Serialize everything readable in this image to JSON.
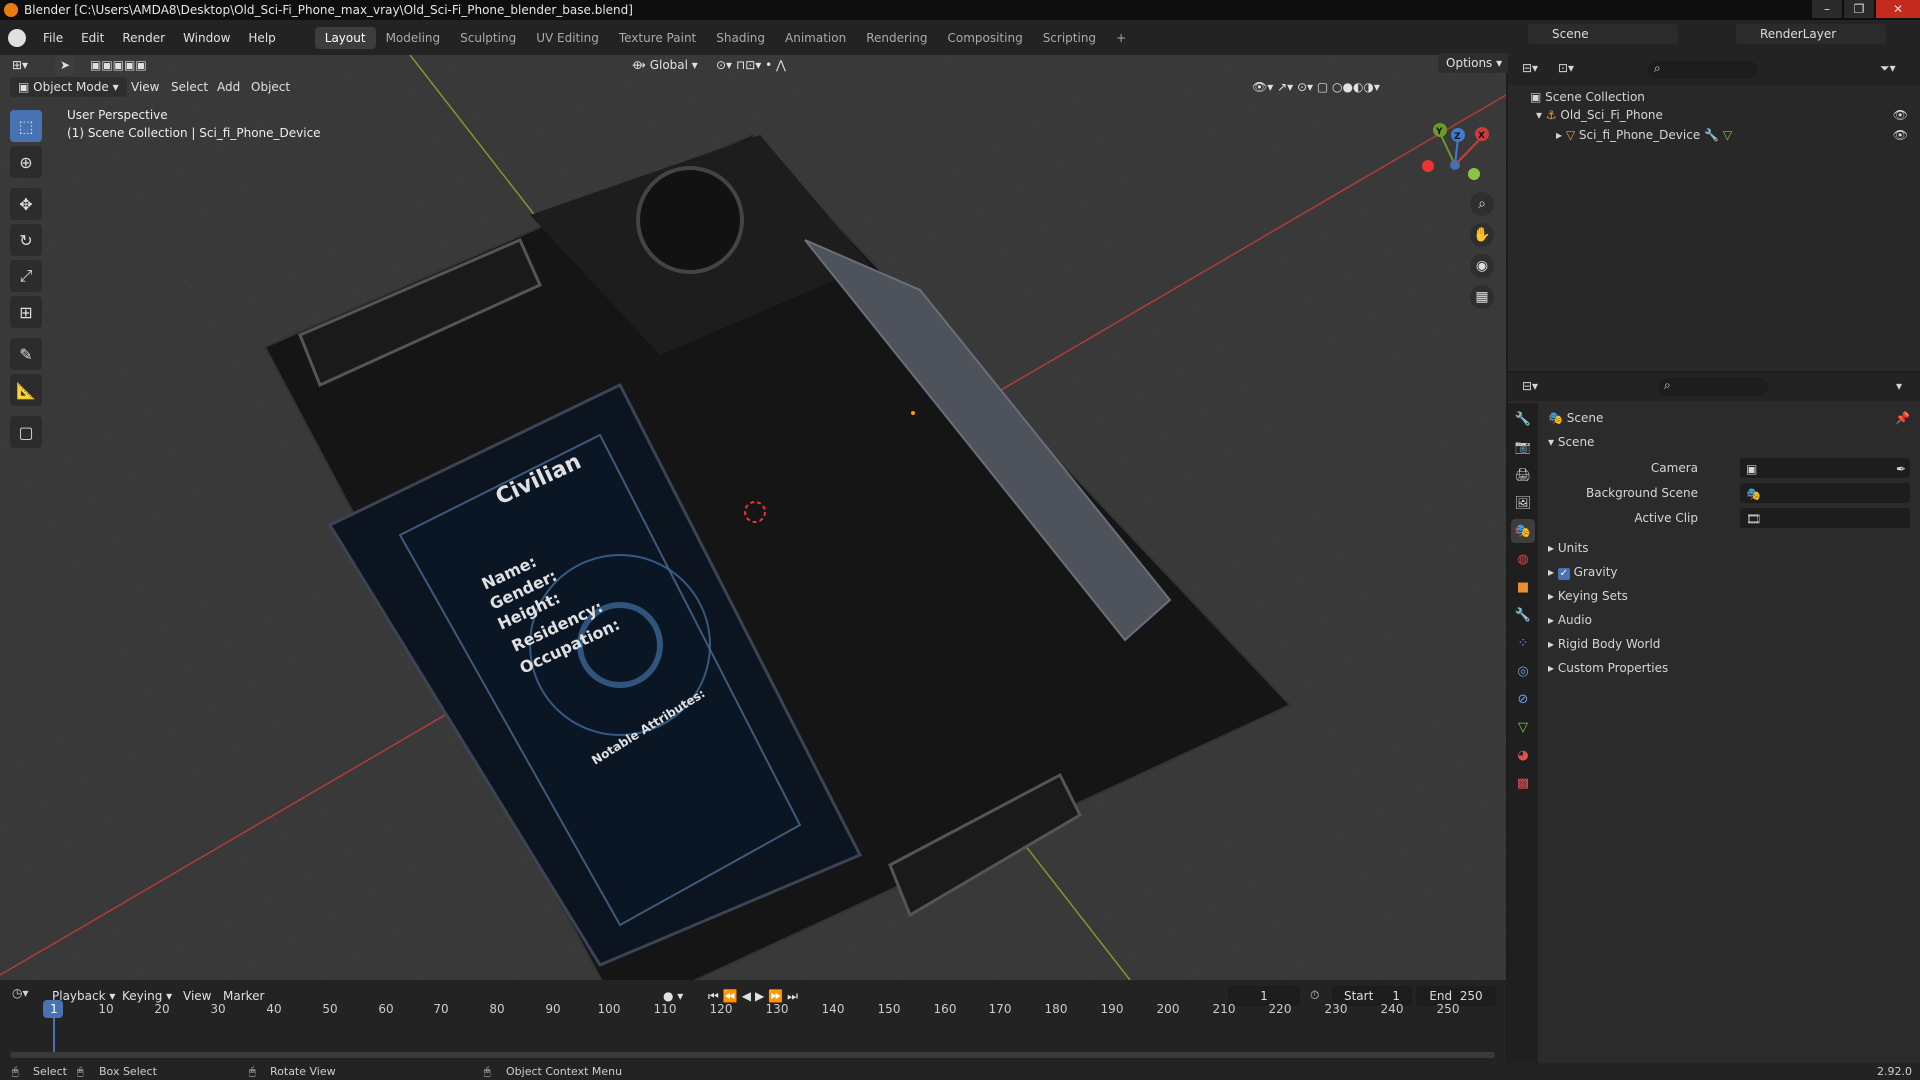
{
  "title": "Blender [C:\\Users\\AMDA8\\Desktop\\Old_Sci-Fi_Phone_max_vray\\Old_Sci-Fi_Phone_blender_base.blend]",
  "menu": [
    "File",
    "Edit",
    "Render",
    "Window",
    "Help"
  ],
  "workspaces": [
    "Layout",
    "Modeling",
    "Sculpting",
    "UV Editing",
    "Texture Paint",
    "Shading",
    "Animation",
    "Rendering",
    "Compositing",
    "Scripting"
  ],
  "active_workspace": "Layout",
  "scene_name": "Scene",
  "view_layer": "RenderLayer",
  "viewport": {
    "mode": "Object Mode",
    "menus": [
      "View",
      "Select",
      "Add",
      "Object"
    ],
    "transform_orientation": "Global",
    "options_label": "Options",
    "perspective": "User Perspective",
    "collection_info": "(1) Scene Collection | Sci_fi_Phone_Device",
    "screen_text": {
      "class": "Civilian",
      "fields": [
        "Name:",
        "Gender:",
        "Height:",
        "Residency:",
        "Occupation:"
      ],
      "notable": "Notable Attributes:"
    },
    "gizmo_axes": [
      "X",
      "Y",
      "Z"
    ]
  },
  "outliner": {
    "root": "Scene Collection",
    "items": [
      {
        "name": "Old_Sci_Fi_Phone",
        "depth": 1
      },
      {
        "name": "Sci_fi_Phone_Device",
        "depth": 2
      }
    ]
  },
  "properties": {
    "header": "Scene",
    "panel": "Scene",
    "fields": [
      {
        "label": "Camera"
      },
      {
        "label": "Background Scene"
      },
      {
        "label": "Active Clip"
      }
    ],
    "sections": [
      "Units",
      "Gravity",
      "Keying Sets",
      "Audio",
      "Rigid Body World",
      "Custom Properties"
    ],
    "gravity_checked": true
  },
  "timeline": {
    "menus": [
      "Playback",
      "Keying",
      "View",
      "Marker"
    ],
    "current_frame": "1",
    "start_label": "Start",
    "start": "1",
    "end_label": "End",
    "end": "250",
    "ticks": [
      "1",
      "10",
      "20",
      "30",
      "40",
      "50",
      "60",
      "70",
      "80",
      "90",
      "100",
      "110",
      "120",
      "130",
      "140",
      "150",
      "160",
      "170",
      "180",
      "190",
      "200",
      "210",
      "220",
      "230",
      "240",
      "250"
    ]
  },
  "statusbar": {
    "select": "Select",
    "box_select": "Box Select",
    "rotate": "Rotate View",
    "context": "Object Context Menu",
    "version": "2.92.0"
  }
}
